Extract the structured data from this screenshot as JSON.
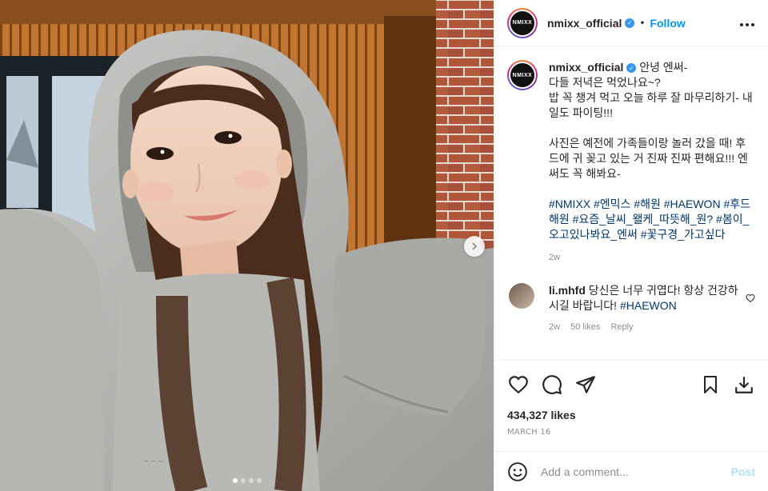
{
  "post": {
    "username": "nmixx_official",
    "avatar_text": "NMIXX",
    "follow_label": "Follow",
    "dot_separator": "•",
    "more_icon": "more-horizontal-icon",
    "caption": "안녕 엔써-\n다들 저녁은 먹었나요~?\n밥 꼭 챙겨 먹고 오늘 하루 잘 마무리하기- 내일도 파이팅!!!\n\n사진은 예전에 가족들이랑 놀러 갔을 때! 후드에 귀 꽂고 있는 거 진짜 진짜 편해요!!! 엔써도 꼭 해봐요-",
    "hashtags_1": "#NMIXX #엔믹스 #해원 #HAEWON",
    "hashtags_2": "#후드해원 #요즘_날씨_왤케_따뜻해_원? #봄이_오고있나봐요_엔써 #꽃구경_가고싶다",
    "caption_time": "2w",
    "likes": "434,327 likes",
    "date": "MARCH 16"
  },
  "comment": {
    "username": "li.mhfd",
    "text": "당신은 너무 귀엽다! 항상 건강하시길 바랍니다!",
    "tag": "#HAEWON",
    "time": "2w",
    "likes": "50 likes",
    "reply": "Reply"
  },
  "add_comment": {
    "placeholder": "Add a comment...",
    "post_label": "Post"
  },
  "carousel": {
    "count": 4,
    "active": 0
  },
  "colors": {
    "link": "#0095f6",
    "hashtag": "#00376b",
    "muted": "#8e8e8e"
  }
}
